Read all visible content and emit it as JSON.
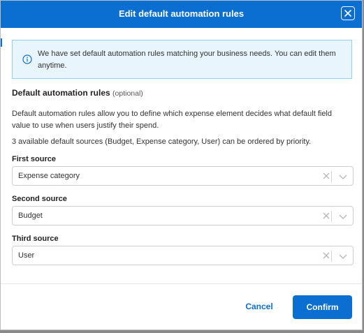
{
  "header": {
    "title": "Edit default automation rules"
  },
  "info": {
    "message": "We have set default automation rules matching your business needs. You can edit them anytime."
  },
  "section": {
    "title": "Default automation rules",
    "optional": "(optional)",
    "description": "Default automation rules allow you to define which expense element decides what default field value to use when users justify their spend.",
    "sources_note": "3 available default sources (Budget, Expense category, User) can be ordered by priority."
  },
  "fields": [
    {
      "label": "First source",
      "value": "Expense category"
    },
    {
      "label": "Second source",
      "value": "Budget"
    },
    {
      "label": "Third source",
      "value": "User"
    }
  ],
  "footer": {
    "cancel_label": "Cancel",
    "confirm_label": "Confirm"
  },
  "colors": {
    "primary": "#0b6fd1",
    "info_bg": "#e8f5fc",
    "info_border": "#8ed1f0"
  },
  "icons": {
    "close": "close-icon",
    "info": "info-icon",
    "clear": "clear-icon",
    "dropdown": "chevron-down-icon"
  }
}
